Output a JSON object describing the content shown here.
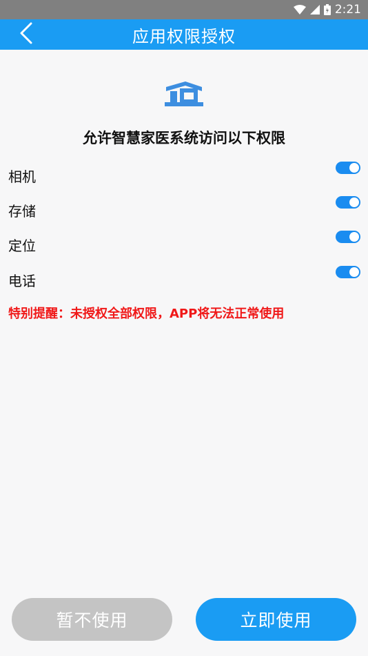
{
  "status_bar": {
    "time": "2:21",
    "icons": [
      "wifi-icon",
      "signal-icon",
      "battery-icon"
    ]
  },
  "header": {
    "title": "应用权限授权",
    "back_icon": "chevron-left-icon"
  },
  "logo": {
    "icon": "house-logo-icon",
    "color": "#3d8ee0"
  },
  "heading": "允许智慧家医系统访问以下权限",
  "permissions": [
    {
      "label": "相机",
      "enabled": true
    },
    {
      "label": "存储",
      "enabled": true
    },
    {
      "label": "定位",
      "enabled": true
    },
    {
      "label": "电话",
      "enabled": true
    }
  ],
  "warning": "特别提醒：未授权全部权限，APP将无法正常使用",
  "buttons": {
    "deny": "暂不使用",
    "accept": "立即使用"
  },
  "colors": {
    "primary": "#1a9cf3",
    "toggle_on": "#1a8cf0",
    "warning": "#f01818",
    "deny_button": "#c4c4c4",
    "status_bar": "#808080"
  }
}
